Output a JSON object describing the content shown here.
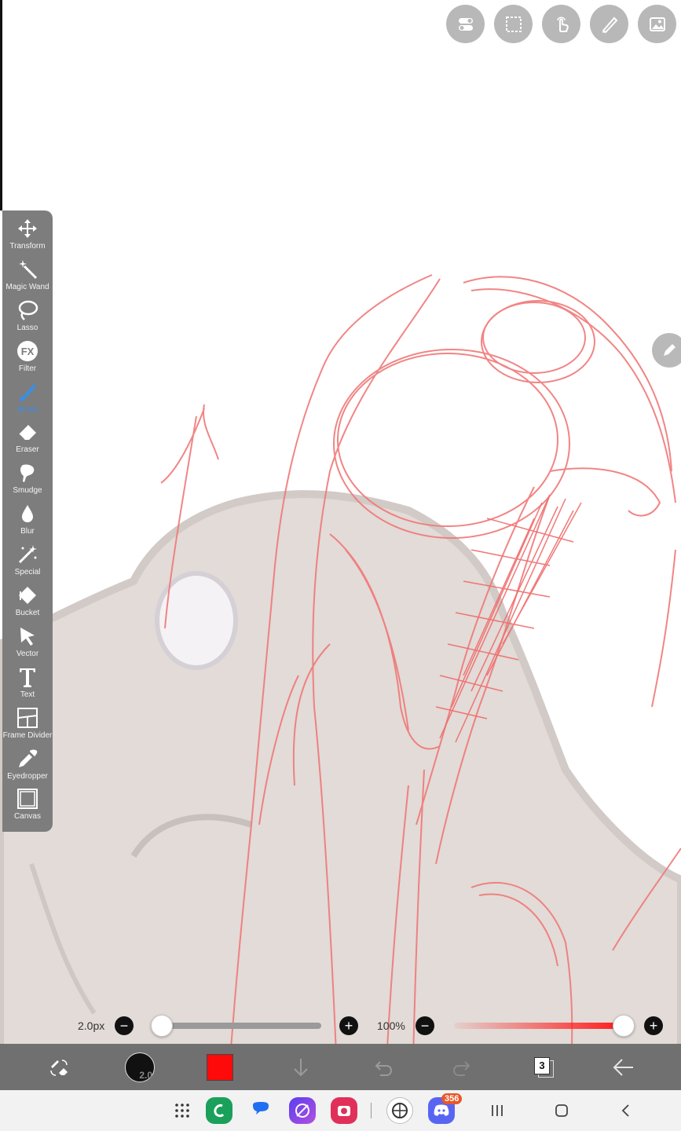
{
  "toolbar": {
    "tools": [
      {
        "label": "Transform",
        "icon": "transform-icon"
      },
      {
        "label": "Magic Wand",
        "icon": "magic-wand-icon"
      },
      {
        "label": "Lasso",
        "icon": "lasso-icon"
      },
      {
        "label": "Filter",
        "icon": "fx-icon"
      },
      {
        "label": "Brush",
        "icon": "brush-icon",
        "active": true
      },
      {
        "label": "Eraser",
        "icon": "eraser-icon"
      },
      {
        "label": "Smudge",
        "icon": "smudge-icon"
      },
      {
        "label": "Blur",
        "icon": "blur-drop-icon"
      },
      {
        "label": "Special",
        "icon": "special-icon"
      },
      {
        "label": "Bucket",
        "icon": "bucket-icon"
      },
      {
        "label": "Vector",
        "icon": "vector-cursor-icon"
      },
      {
        "label": "Text",
        "icon": "text-icon"
      },
      {
        "label": "Frame Divider",
        "icon": "frame-divider-icon"
      },
      {
        "label": "Eyedropper",
        "icon": "eyedropper-icon"
      },
      {
        "label": "Canvas",
        "icon": "canvas-icon"
      }
    ],
    "fx_text": "FX"
  },
  "top_tools": [
    "settings-toggle-icon",
    "selection-icon",
    "touch-icon",
    "ruler-pencil-icon",
    "image-icon"
  ],
  "brush": {
    "size_label": "2.0px",
    "size_value": 2.0,
    "size_fraction": 0.0,
    "size_circle_text": "2.0",
    "opacity_label": "100%",
    "opacity_fraction": 1.0,
    "minus": "−",
    "plus": "+"
  },
  "bottom_bar": {
    "color": "#ff0a0a",
    "layer_count": "3"
  },
  "nav": {
    "discord_badge": "356"
  },
  "colors": {
    "toolbar_bg": "#7d7d7d",
    "accent": "#3a8ee6",
    "sketch": "#f07878",
    "underlayer": "#ddd6d2"
  }
}
